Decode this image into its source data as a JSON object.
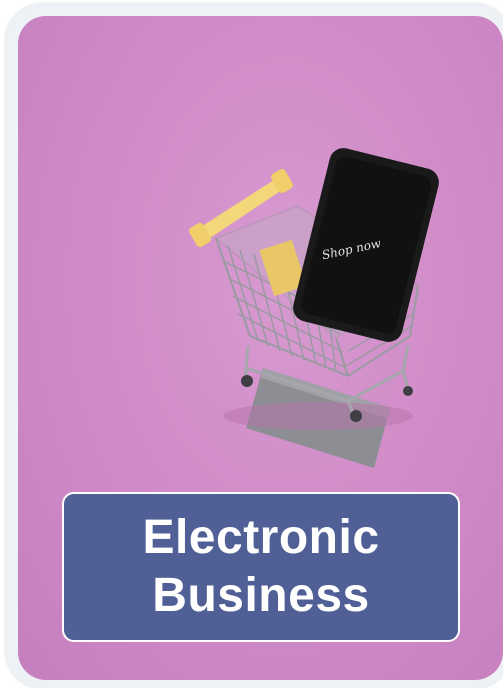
{
  "card": {
    "title_line1": "Electronic",
    "title_line2": "Business",
    "phone_screen_text": "Shop now"
  },
  "colors": {
    "background": "#d08cc8",
    "title_box": "#506096",
    "title_text": "#ffffff",
    "cart_handle": "#f3d77a",
    "phone": "#1a1a1a"
  },
  "icons": {
    "illustration": "shopping-cart-with-smartphone"
  }
}
